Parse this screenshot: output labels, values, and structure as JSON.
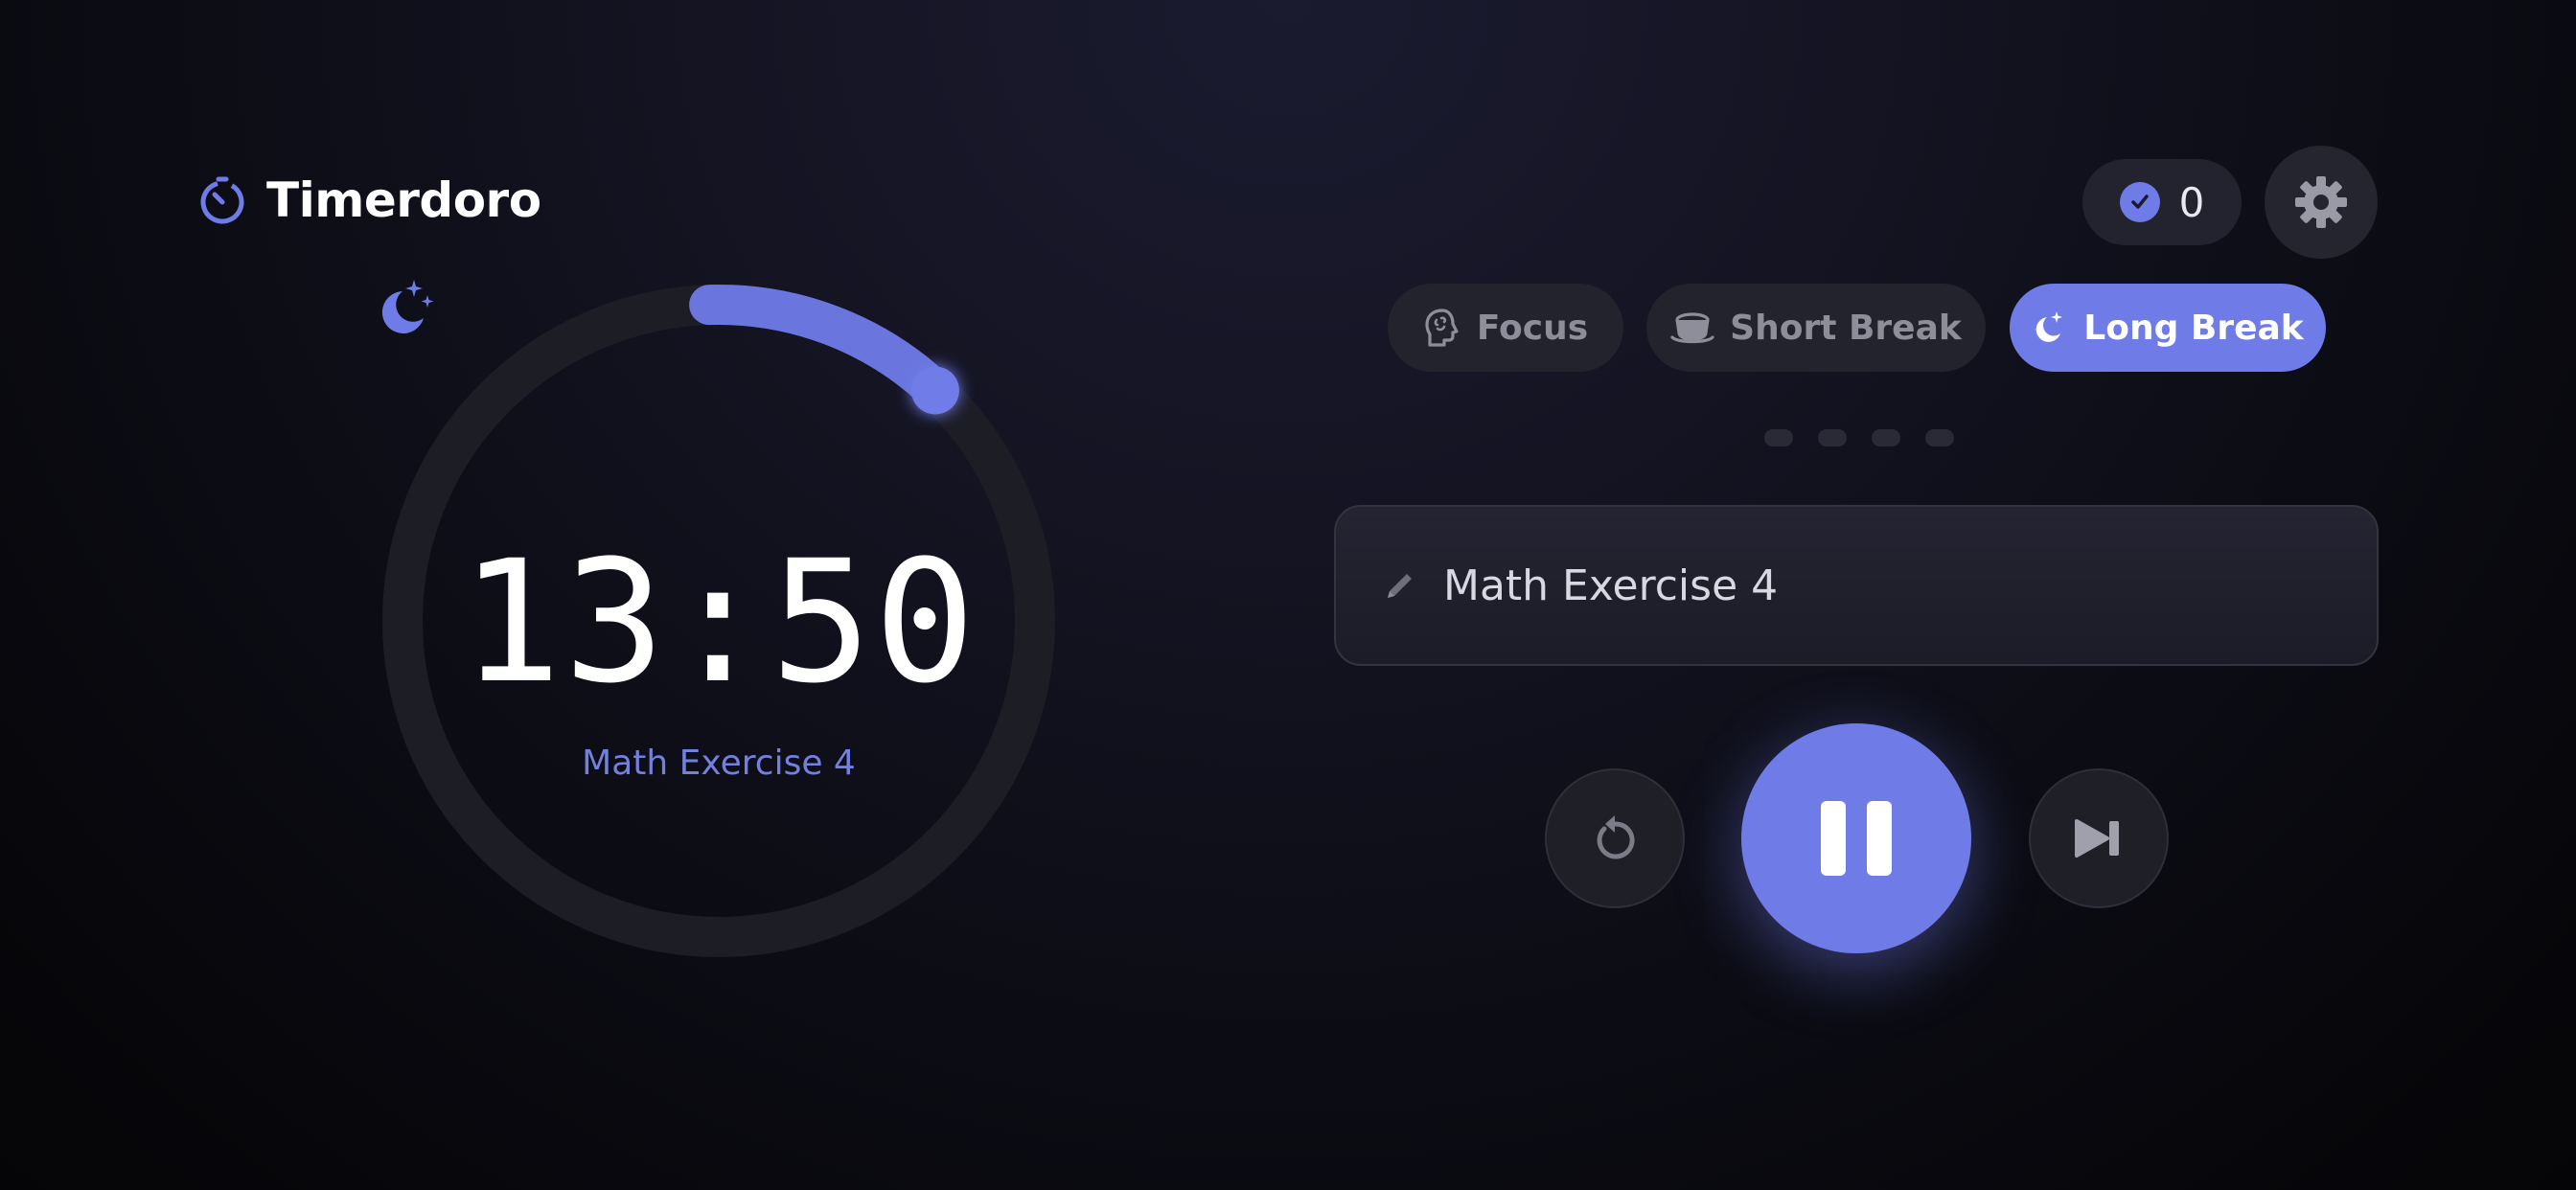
{
  "app": {
    "title": "Timerdoro",
    "accent_color": "#6f7ce8"
  },
  "completed_count": "0",
  "timer": {
    "time": "13:50",
    "task_label": "Math Exercise 4",
    "progress": 0.12,
    "mode_icon": "moon-stars-icon"
  },
  "tabs": [
    {
      "label": "Focus",
      "icon": "brain-head-icon",
      "active": false
    },
    {
      "label": "Short Break",
      "icon": "coffee-cup-icon",
      "active": false
    },
    {
      "label": "Long Break",
      "icon": "moon-stars-icon",
      "active": true
    }
  ],
  "session_dots": 4,
  "task_input": {
    "value": "Math Exercise 4",
    "icon": "pencil-icon"
  },
  "controls": {
    "reset_icon": "reset-icon",
    "play_icon": "pause-icon",
    "skip_icon": "skip-next-icon"
  }
}
